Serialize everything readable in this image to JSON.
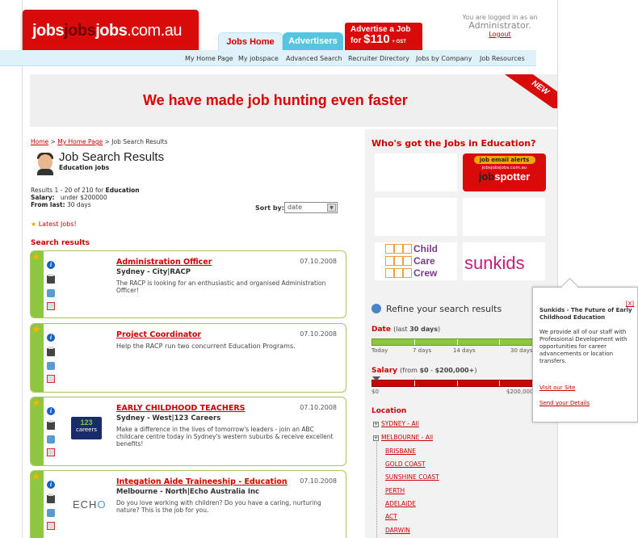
{
  "header": {
    "logo": {
      "a": "jobs",
      "b": "jobs",
      "c": "jobs",
      "d": ".com.au"
    },
    "tabs": [
      "Jobs Home",
      "Advertisers"
    ],
    "advertise": {
      "line1": "Advertise a Job",
      "line2": "for",
      "price": "$110",
      "gst": "+ GST"
    },
    "login": {
      "line1": "You are logged in as an",
      "user": "Administrator.",
      "logout": "Logout"
    }
  },
  "subnav": [
    "My Home Page",
    "My jobspace",
    "Advanced Search",
    "Recruiter Directory",
    "Jobs by Company",
    "Job Resources"
  ],
  "banner": {
    "text": "We have made job hunting even faster",
    "ribbon": "NEW"
  },
  "breadcrumb": {
    "home": "Home",
    "sep1": ">",
    "myhome": "My Home Page",
    "sep2": ">",
    "current": "Job Search Results"
  },
  "page": {
    "title": "Job Search Results",
    "subtitle": "Education jobs"
  },
  "results": {
    "line1": "Results 1 - 20 of 210 for",
    "category": "Education",
    "salary_label": "Salary:",
    "salary": "under $200000",
    "from_label": "From last:",
    "from": "30 days"
  },
  "sort": {
    "label": "Sort by:",
    "value": "date"
  },
  "latest": "Latest Jobs!",
  "search_results_label": "Search results",
  "jobs": [
    {
      "title": "Administration Officer",
      "date": "07.10.2008",
      "location": "Sydney - City|RACP",
      "desc": "The RACP is looking for an enthusiastic and organised Administration Officer!"
    },
    {
      "title": "Project Coordinator",
      "date": "07.10.2008",
      "location": "Sydney - City|RACP",
      "desc": "Help the RACP run two concurrent Education Programs."
    },
    {
      "title": "EARLY CHILDHOOD TEACHERS",
      "date": "07.10.2008",
      "location": "Sydney - West|123 Careers",
      "desc": "Make a difference in the lives of tomorrow's leaders - join an ABC childcare centre today in Sydney's western suburbs & receive excellent benefits!"
    },
    {
      "title": "Integation Aide Traineeship - Education",
      "date": "07.10.2008",
      "location": "Melbourne - North|Echo Australia Inc",
      "desc": "Do you love working with children? Do you have a caring, nurturing nature? This is the job for you."
    }
  ],
  "logos": {
    "c123": {
      "digits": "123",
      "word": "careers"
    },
    "echo": {
      "a": "ECH",
      "b": "O"
    }
  },
  "right": {
    "who": "Who's got the Jobs in Education?",
    "jobspotter": {
      "alerts": "job email alerts",
      "site": "jobsjobsjobs.com.au",
      "a": "job",
      "b": "spotter"
    },
    "childcare": {
      "a": "Child",
      "b": "Care",
      "c": "Crew"
    },
    "sunkids": "sunkids",
    "refine": "Refine your search results",
    "date": {
      "label": "Date",
      "pre": "(last",
      "val": "30 days",
      "post": ")",
      "scale": [
        "Today",
        "7 days",
        "14 days",
        "30 days"
      ]
    },
    "salary": {
      "label": "Salary",
      "pre": "(from",
      "v1": "$0",
      "mid": "-",
      "v2": "$200,000+",
      "post": ")",
      "scale": [
        "$0",
        "$200,000+"
      ]
    },
    "location": {
      "label": "Location",
      "items": [
        "SYDNEY - All",
        "MELBOURNE - All",
        "BRISBANE",
        "GOLD COAST",
        "SUNSHINE COAST",
        "PERTH",
        "ADELAIDE",
        "ACT",
        "DARWIN"
      ]
    }
  },
  "popup": {
    "close": "[X]",
    "title": "Sunkids - The Future of Early Childhood Education",
    "body": "We provide all of our staff with Professional Development with opportunities for career advancements or location transfers.",
    "visit": "Visit our Site",
    "send": "Send your Details"
  }
}
